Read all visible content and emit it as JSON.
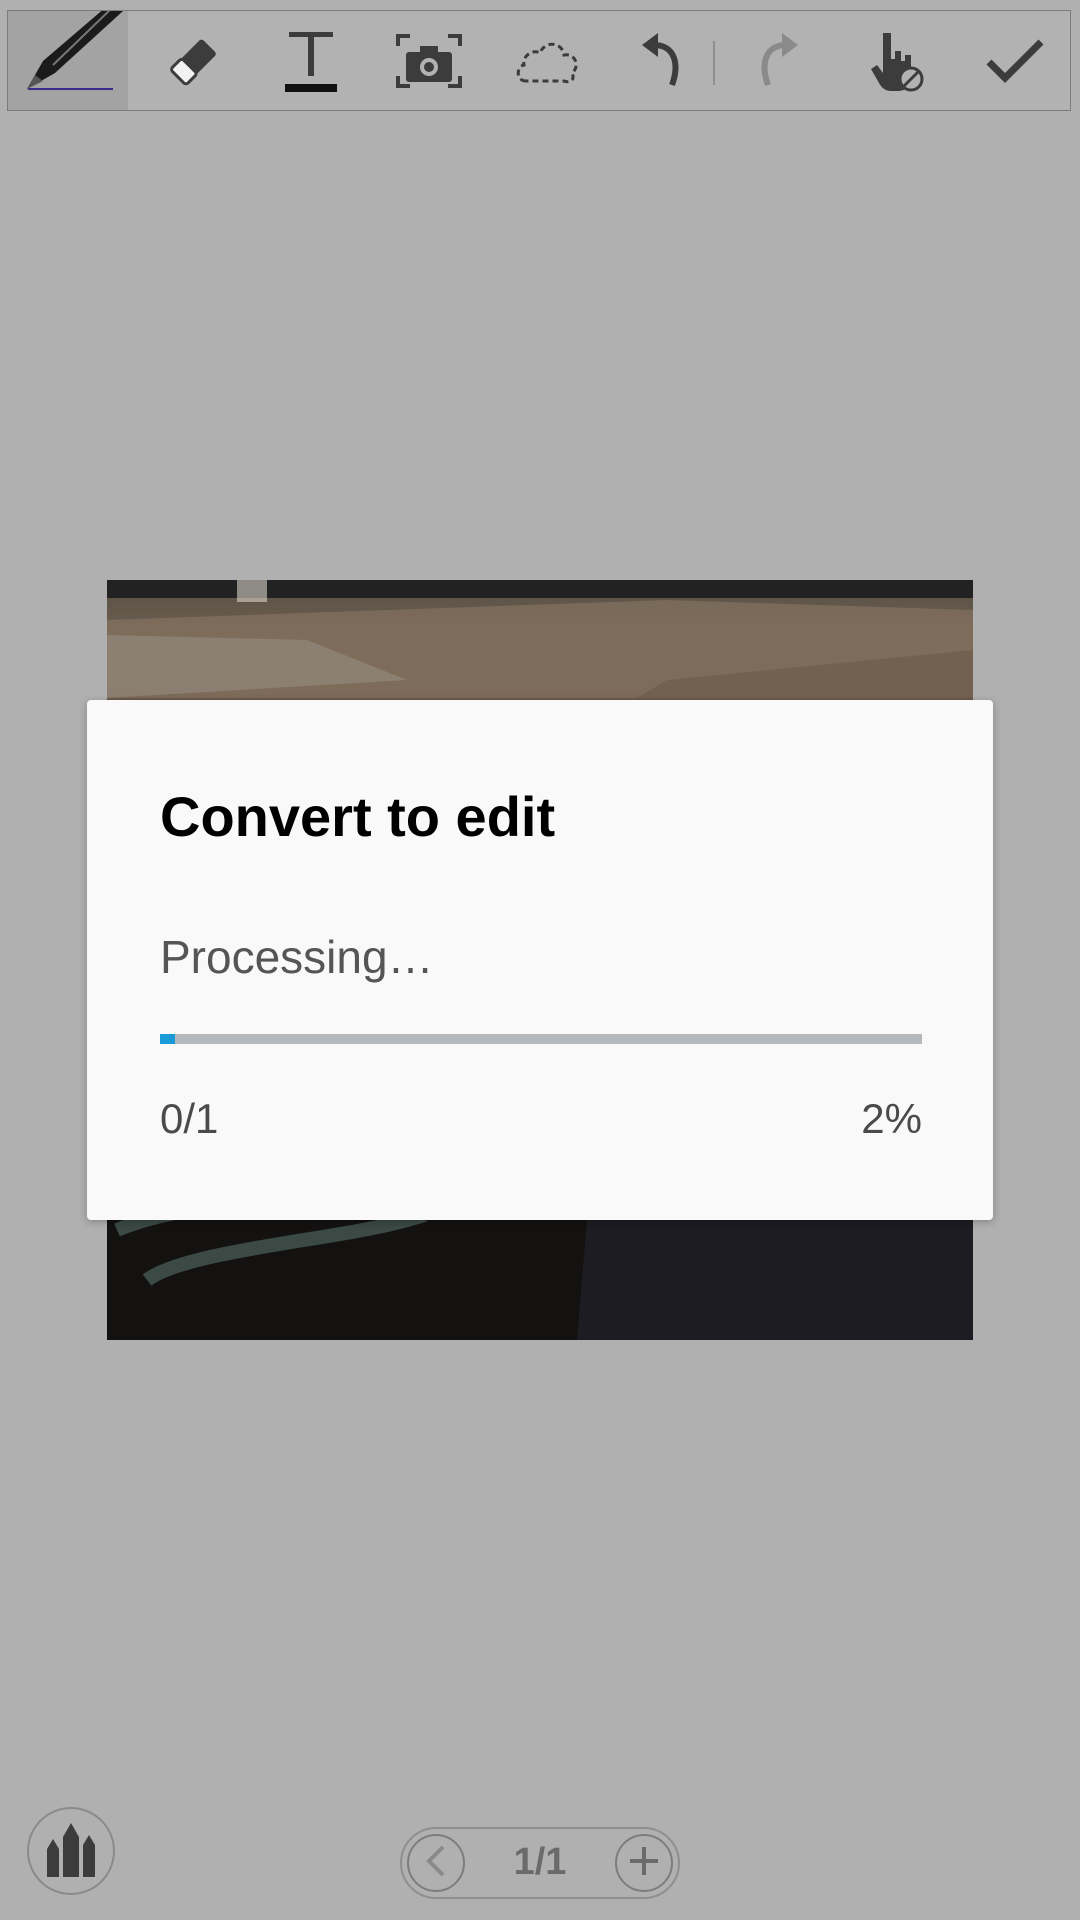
{
  "toolbar": {
    "tools": [
      {
        "icon": "pen-icon",
        "selected": true
      },
      {
        "icon": "eraser-icon"
      },
      {
        "icon": "text-icon"
      },
      {
        "icon": "camera-capture-icon"
      },
      {
        "icon": "lasso-select-icon"
      },
      {
        "icon": "undo-icon"
      },
      {
        "icon": "redo-icon",
        "disabled": true
      },
      {
        "icon": "touch-disabled-icon"
      },
      {
        "icon": "checkmark-icon"
      }
    ]
  },
  "dialog": {
    "title": "Convert to edit",
    "message": "Processing…",
    "progress_fraction": 0.02,
    "progress_count": "0/1",
    "progress_percent": "2%",
    "accent_color": "#1a9ad6"
  },
  "pager": {
    "label": "1/1",
    "prev_icon": "chevron-left-icon",
    "add_icon": "plus-icon"
  },
  "brush_button": {
    "icon": "pencils-icon"
  }
}
